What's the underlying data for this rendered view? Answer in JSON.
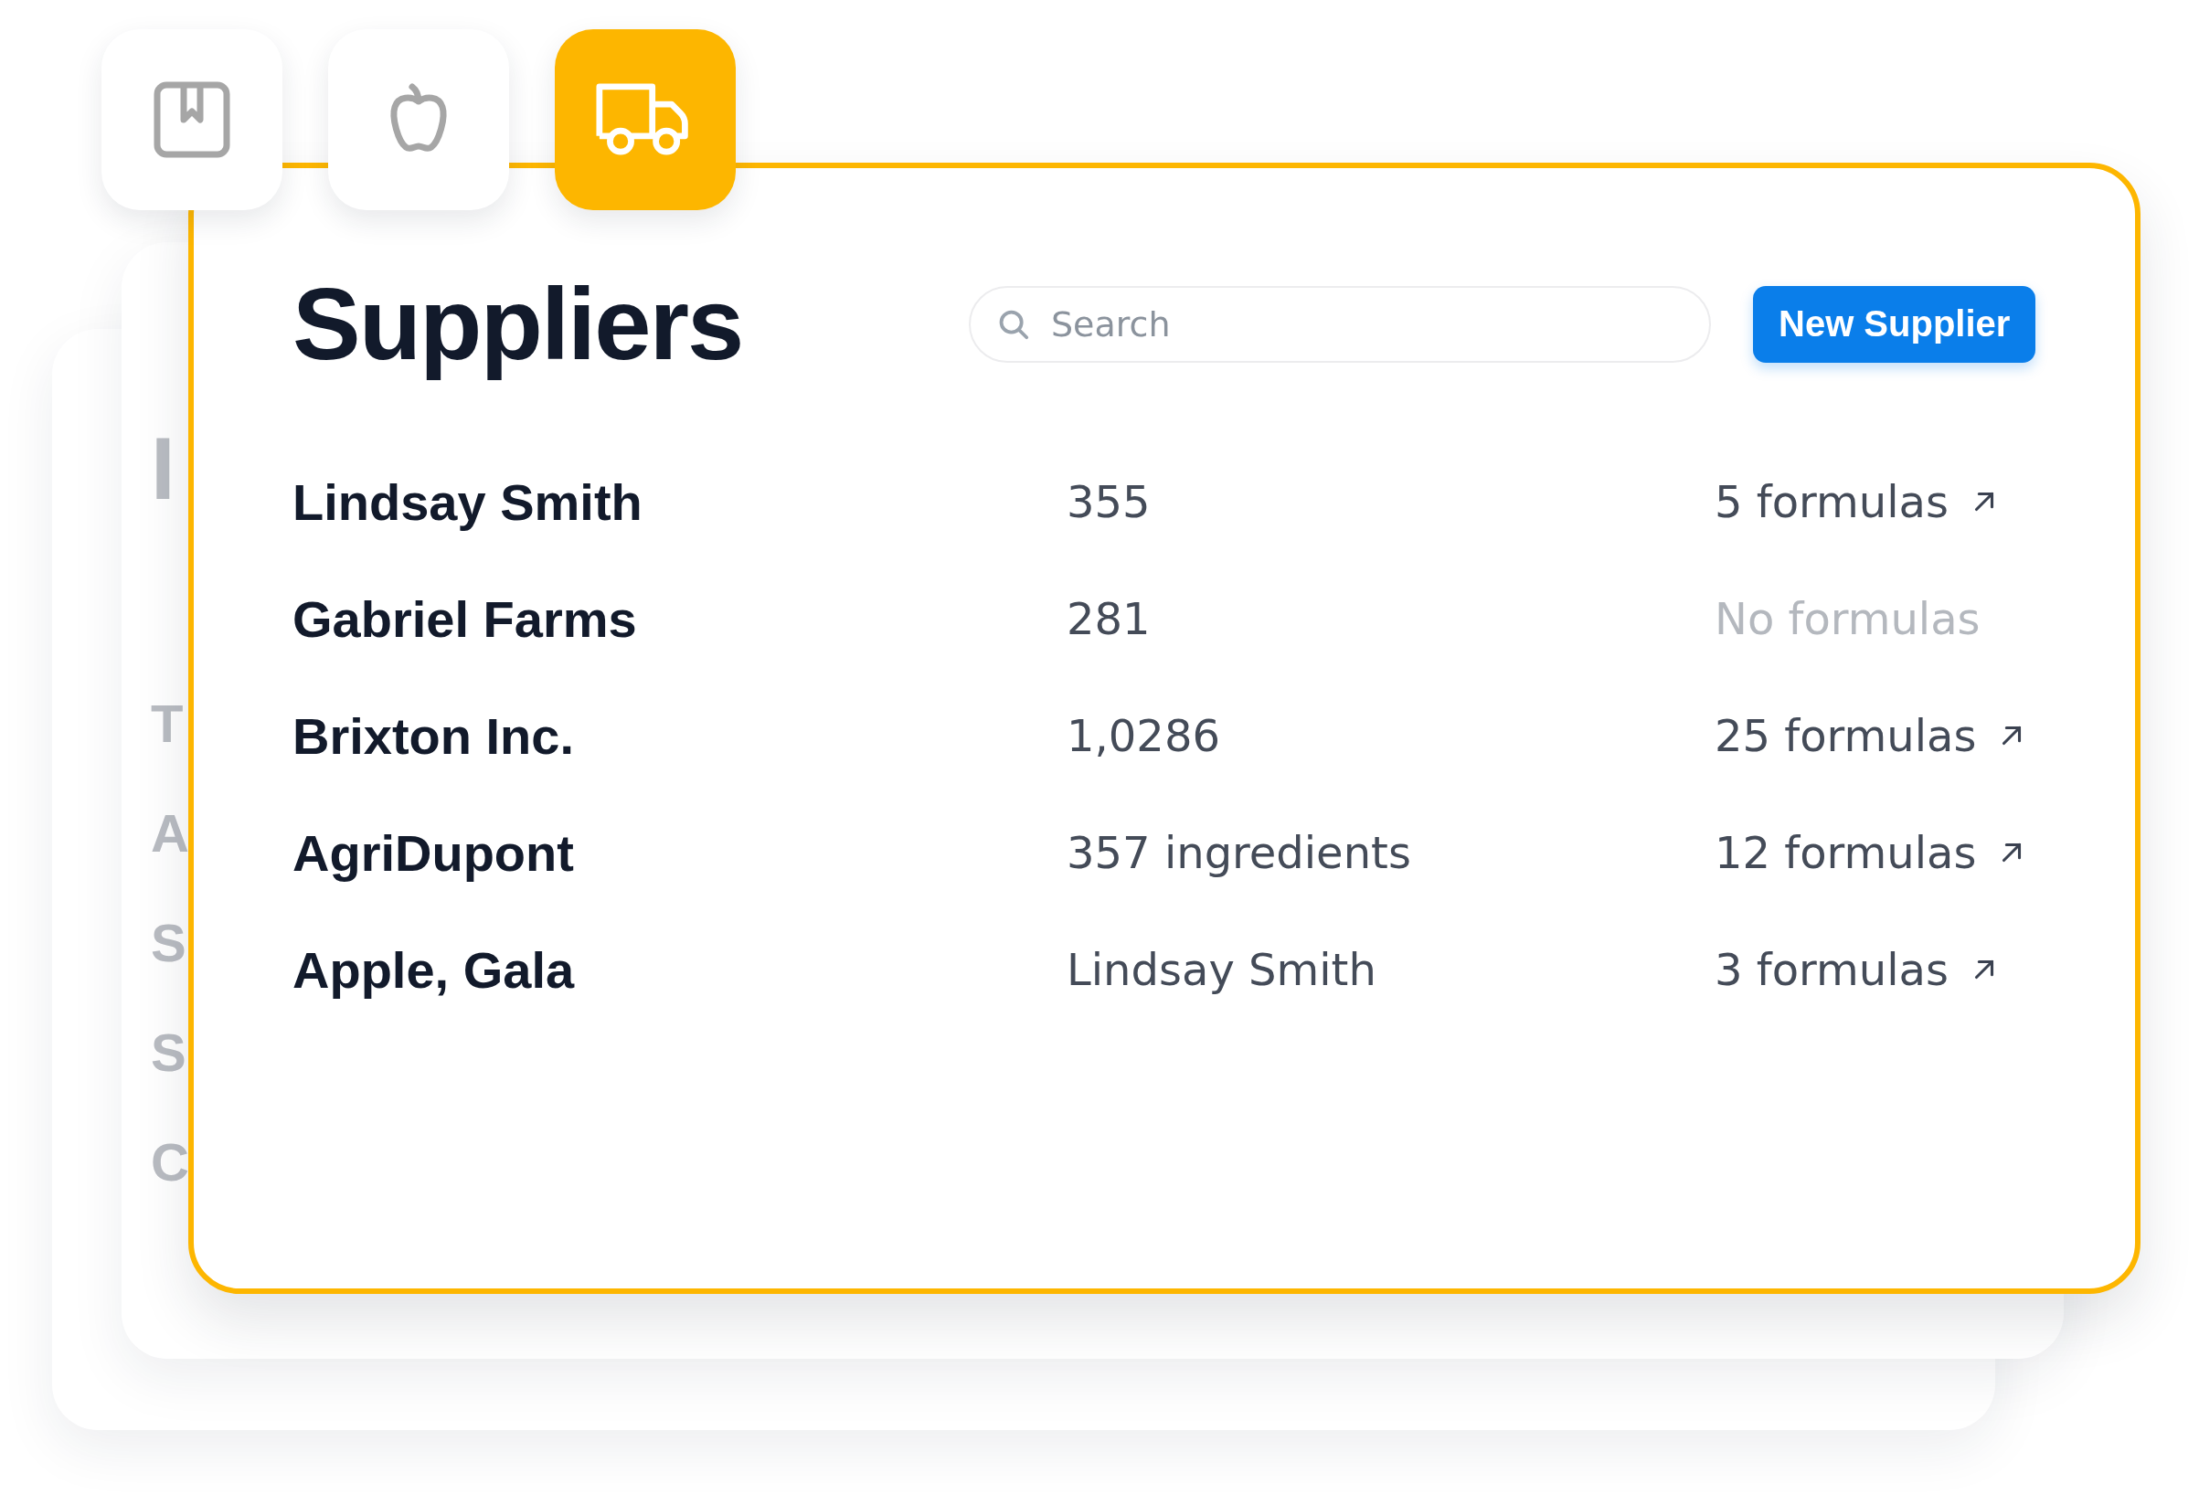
{
  "background_card": {
    "lines": [
      "I",
      "T",
      "A",
      "S",
      "S",
      "C"
    ]
  },
  "tabs": [
    {
      "kind": "box",
      "selected": false
    },
    {
      "kind": "apple",
      "selected": false
    },
    {
      "kind": "truck",
      "selected": true
    }
  ],
  "title": "Suppliers",
  "search": {
    "placeholder": "Search"
  },
  "new_button": "New Supplier",
  "rows": [
    {
      "name": "Lindsay Smith",
      "detail": "355",
      "formulas": "5 formulas",
      "linked": true
    },
    {
      "name": "Gabriel Farms",
      "detail": "281",
      "formulas": "No formulas",
      "linked": false
    },
    {
      "name": "Brixton Inc.",
      "detail": "1,0286",
      "formulas": "25 formulas",
      "linked": true
    },
    {
      "name": "AgriDupont",
      "detail": "357 ingredients",
      "formulas": "12 formulas",
      "linked": true
    },
    {
      "name": "Apple, Gala",
      "detail": "Lindsay Smith",
      "formulas": "3 formulas",
      "linked": true
    }
  ]
}
